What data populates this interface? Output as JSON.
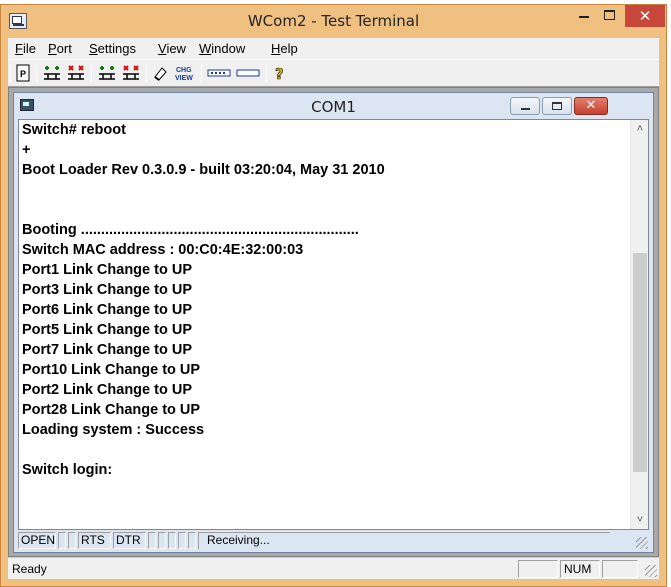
{
  "app": {
    "title": "WCom2 - Test Terminal",
    "close_glyph": "✕"
  },
  "menu": {
    "items": [
      {
        "accel": "F",
        "rest": "ile"
      },
      {
        "accel": "P",
        "rest": "ort"
      },
      {
        "accel": "S",
        "rest": "ettings"
      },
      {
        "accel": "V",
        "rest": "iew"
      },
      {
        "accel": "W",
        "rest": "indow"
      },
      {
        "accel": "H",
        "rest": "elp"
      }
    ]
  },
  "toolbar": {
    "icons": [
      "properties-icon",
      "connect-icon",
      "disconnect-icon",
      "connect-all-icon",
      "disconnect-all-icon",
      "clear-icon",
      "change-view-icon",
      "hex-view-icon",
      "line-view-icon",
      "help-icon"
    ],
    "chg_view_text": "CHG VIEW"
  },
  "child": {
    "title": "COM1",
    "close_glyph": "✕"
  },
  "terminal": {
    "lines": [
      "Switch# reboot",
      "+",
      "Boot Loader Rev 0.3.0.9 - built 03:20:04, May 31 2010",
      "",
      "",
      "Booting .....................................................................",
      "Switch MAC address : 00:C0:4E:32:00:03",
      "Port1 Link Change to UP",
      "Port3 Link Change to UP",
      "Port6 Link Change to UP",
      "Port5 Link Change to UP",
      "Port7 Link Change to UP",
      "Port10 Link Change to UP",
      "Port2 Link Change to UP",
      "Port28 Link Change to UP",
      "Loading system : Success",
      "",
      "Switch login:"
    ]
  },
  "port_status": {
    "open": "OPEN",
    "rts": "RTS",
    "dtr": "DTR",
    "activity": "Receiving..."
  },
  "statusbar": {
    "text": "Ready",
    "num": "NUM"
  }
}
